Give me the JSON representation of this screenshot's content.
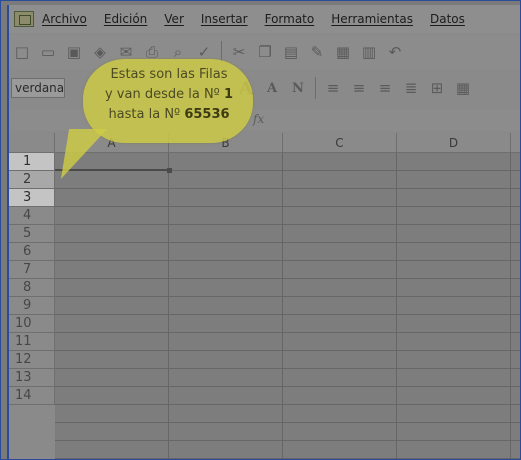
{
  "menubar": {
    "items": [
      "Archivo",
      "Edición",
      "Ver",
      "Insertar",
      "Formato",
      "Herramientas",
      "Datos"
    ]
  },
  "toolbar2": {
    "font_name": "verdana"
  },
  "callout": {
    "line1": "Estas son las Filas",
    "line2_pre": "y van desde la Nº ",
    "line2_num": "1",
    "line3_pre": "hasta la Nº ",
    "line3_num": "65536"
  },
  "columns": [
    "A",
    "B",
    "C",
    "D"
  ],
  "rows": [
    "1",
    "2",
    "3",
    "4",
    "5",
    "6",
    "7",
    "8",
    "9",
    "10",
    "11",
    "12",
    "13",
    "14"
  ],
  "icons": {
    "menu": "app-icon",
    "toolbar": [
      "new-icon",
      "open-icon",
      "save-icon",
      "permission-icon",
      "email-icon",
      "print-icon",
      "print-preview-icon",
      "spellcheck-icon",
      "cut-icon",
      "copy-icon",
      "paste-icon",
      "format-painter-icon",
      "insert-date-icon",
      "insert-number-icon",
      "undo-icon"
    ],
    "formatting": [
      "increase-font-icon",
      "decrease-font-icon",
      "bold-icon",
      "align-left-icon",
      "align-center-icon",
      "align-right-icon",
      "justify-icon",
      "merge-cells-icon",
      "table-icon"
    ],
    "formula": "fx-icon"
  }
}
